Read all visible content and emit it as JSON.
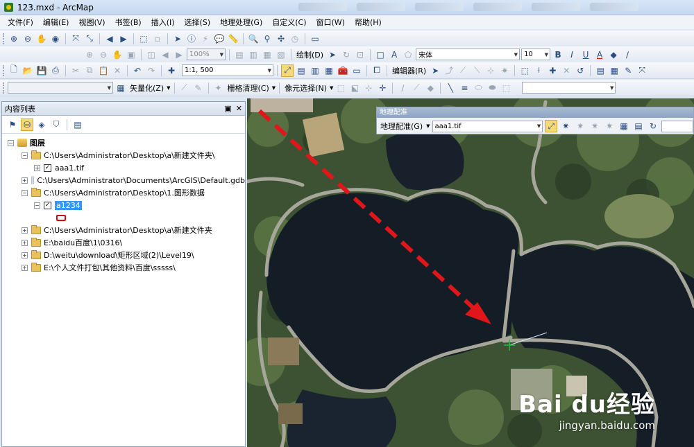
{
  "title": {
    "app_title": "123.mxd - ArcMap"
  },
  "menus": [
    "文件(F)",
    "编辑(E)",
    "视图(V)",
    "书签(B)",
    "插入(I)",
    "选择(S)",
    "地理处理(G)",
    "自定义(C)",
    "窗口(W)",
    "帮助(H)"
  ],
  "toolbar2": {
    "zoom_value": "100%",
    "draw_label": "绘制(D)",
    "font_name": "宋体",
    "font_size": "10",
    "bold": "B",
    "italic": "I",
    "underline": "U",
    "font_color": "A"
  },
  "toolbar3": {
    "scale_value": "1:1, 500",
    "editor_label": "编辑器(R)"
  },
  "toolbar4": {
    "vectorize_label": "矢量化(Z)",
    "raster_clean_label": "栅格清理(C)",
    "cell_select_label": "像元选择(N)"
  },
  "toc": {
    "title": "内容列表",
    "pin": "▣",
    "close": "✕",
    "root_label": "图层",
    "items": [
      {
        "label": "C:\\Users\\Administrator\\Desktop\\a\\新建文件夹\\"
      },
      {
        "label": "aaa1.tif"
      },
      {
        "label": "C:\\Users\\Administrator\\Documents\\ArcGIS\\Default.gdb"
      },
      {
        "label": "C:\\Users\\Administrator\\Desktop\\1.图形数据"
      },
      {
        "label": "a1234"
      },
      {
        "label": "C:\\Users\\Administrator\\Desktop\\a\\新建文件夹"
      },
      {
        "label": "E:\\baidu百度\\1\\0316\\"
      },
      {
        "label": "D:\\weitu\\download\\矩形区域(2)\\Level19\\"
      },
      {
        "label": "E:\\个人文件打包\\其他资料\\百度\\sssss\\"
      }
    ]
  },
  "georef": {
    "title": "地理配准",
    "menu_label": "地理配准(G)",
    "layer_value": "aaa1.tif"
  },
  "watermark": {
    "brand": "Bai du经验",
    "url": "jingyan.baidu.com"
  },
  "colors": {
    "arrow": "#e0161a",
    "highlight": "#3399ff"
  }
}
